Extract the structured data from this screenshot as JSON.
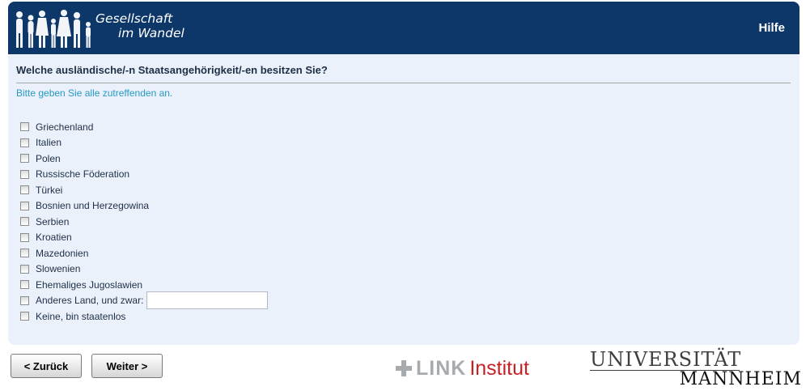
{
  "header": {
    "brand_line1": "Gesellschaft",
    "brand_line2": "im Wandel",
    "help_label": "Hilfe",
    "bg_color": "#0d3669"
  },
  "question": {
    "text": "Welche ausländische/-n Staatsangehörigkeit/-en besitzen Sie?",
    "hint": "Bitte geben Sie alle zutreffenden an."
  },
  "options": [
    {
      "label": "Griechenland",
      "checked": false
    },
    {
      "label": "Italien",
      "checked": false
    },
    {
      "label": "Polen",
      "checked": false
    },
    {
      "label": "Russische Föderation",
      "checked": false
    },
    {
      "label": "Türkei",
      "checked": false
    },
    {
      "label": "Bosnien und Herzegowina",
      "checked": false
    },
    {
      "label": "Serbien",
      "checked": false
    },
    {
      "label": "Kroatien",
      "checked": false
    },
    {
      "label": "Mazedonien",
      "checked": false
    },
    {
      "label": "Slowenien",
      "checked": false
    },
    {
      "label": "Ehemaliges Jugoslawien",
      "checked": false
    },
    {
      "label": "Anderes Land, und zwar:",
      "checked": false,
      "has_input": true,
      "input_value": ""
    },
    {
      "label": "Keine, bin staatenlos",
      "checked": false
    }
  ],
  "nav": {
    "back_label": "< Zurück",
    "next_label": "Weiter >"
  },
  "footer": {
    "link_word": "LINK",
    "institut_word": "Institut",
    "uni_line1": "UNIVERSITÄT",
    "uni_line2": "MANNHEIM"
  }
}
